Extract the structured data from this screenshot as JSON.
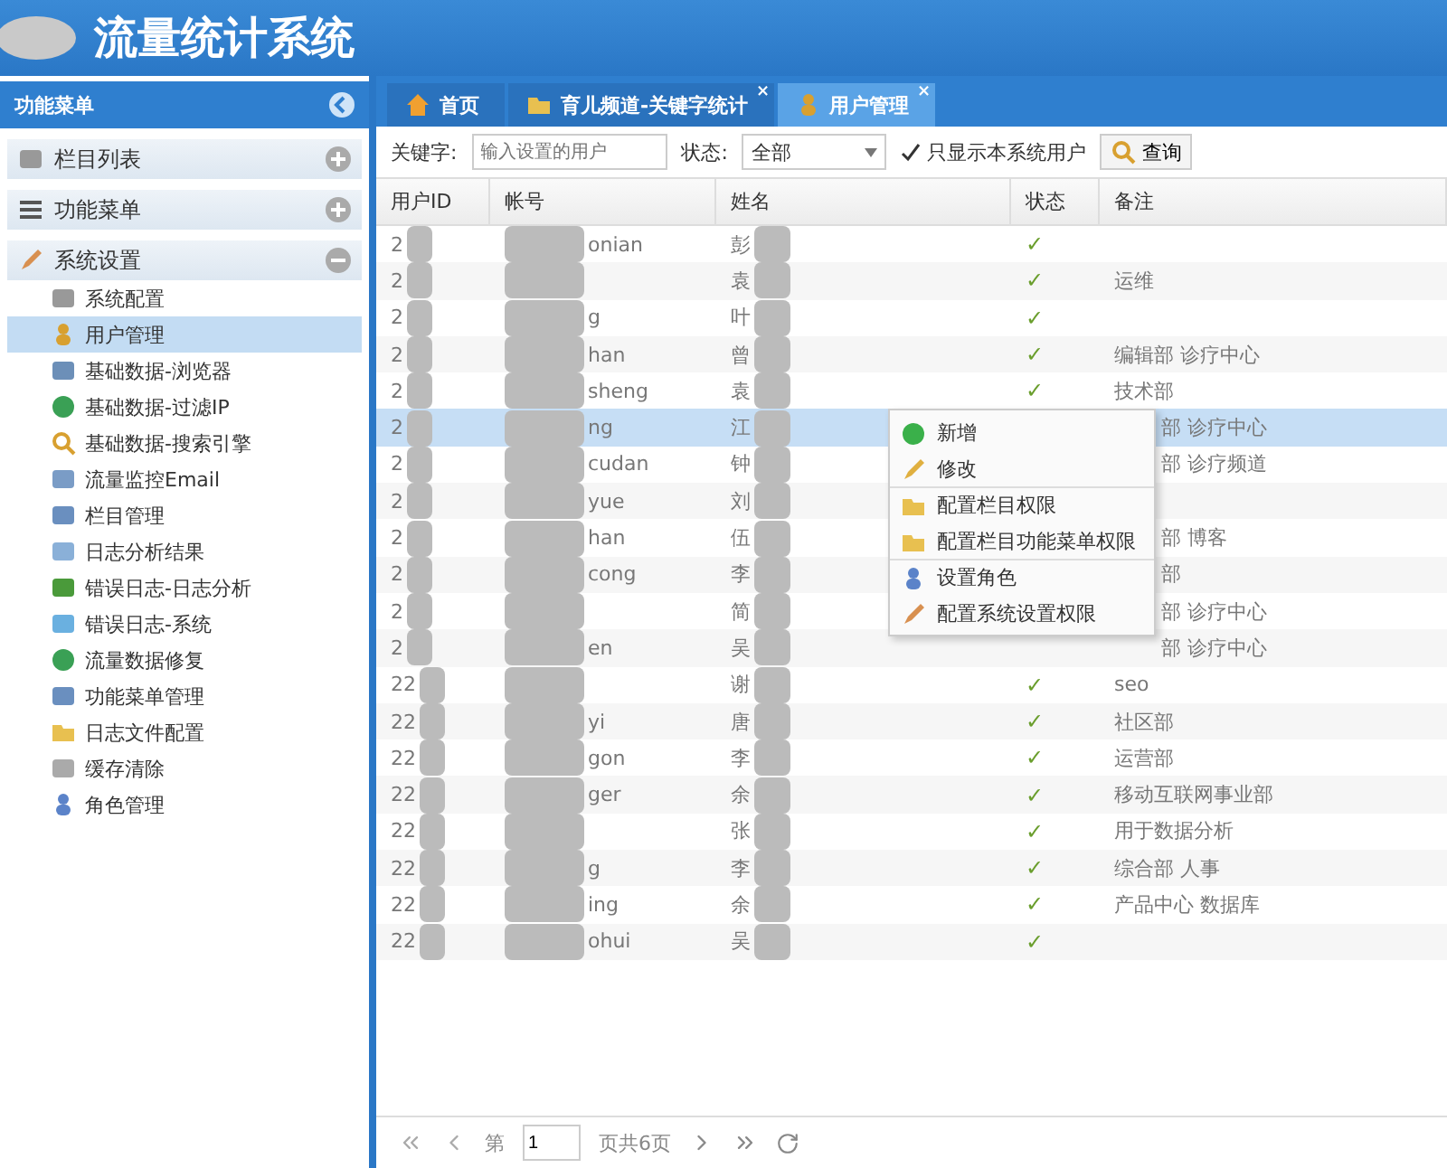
{
  "header": {
    "title": "流量统计系统"
  },
  "sidebar": {
    "title": "功能菜单",
    "sections": [
      {
        "label": "栏目列表",
        "expanded": false
      },
      {
        "label": "功能菜单",
        "expanded": false
      },
      {
        "label": "系统设置",
        "expanded": true,
        "items": [
          {
            "label": "系统配置",
            "selected": false
          },
          {
            "label": "用户管理",
            "selected": true
          },
          {
            "label": "基础数据-浏览器",
            "selected": false
          },
          {
            "label": "基础数据-过滤IP",
            "selected": false
          },
          {
            "label": "基础数据-搜索引擎",
            "selected": false
          },
          {
            "label": "流量监控Email",
            "selected": false
          },
          {
            "label": "栏目管理",
            "selected": false
          },
          {
            "label": "日志分析结果",
            "selected": false
          },
          {
            "label": "错误日志-日志分析",
            "selected": false
          },
          {
            "label": "错误日志-系统",
            "selected": false
          },
          {
            "label": "流量数据修复",
            "selected": false
          },
          {
            "label": "功能菜单管理",
            "selected": false
          },
          {
            "label": "日志文件配置",
            "selected": false
          },
          {
            "label": "缓存清除",
            "selected": false
          },
          {
            "label": "角色管理",
            "selected": false
          }
        ]
      }
    ]
  },
  "tabs": [
    {
      "label": "首页",
      "selected": false
    },
    {
      "label": "育儿频道-关键字统计",
      "selected": false,
      "close": "×"
    },
    {
      "label": "用户管理",
      "selected": true,
      "close": "×"
    }
  ],
  "toolbar": {
    "keyword_label": "关键字:",
    "keyword_placeholder": "输入设置的用户",
    "status_label": "状态:",
    "status_value": "全部",
    "only_system_users": {
      "label": "只显示本系统用户",
      "checked": true
    },
    "query_button": "查询"
  },
  "table": {
    "columns": [
      "用户ID",
      "帐号",
      "姓名",
      "状态",
      "备注"
    ],
    "rows": [
      {
        "id": "2",
        "account": "onian",
        "name": "彭",
        "status": "✓",
        "note": "",
        "selected": false
      },
      {
        "id": "2",
        "account": "",
        "name": "袁",
        "status": "✓",
        "note": "运维",
        "selected": false
      },
      {
        "id": "2",
        "account": "g",
        "name": "叶",
        "status": "✓",
        "note": "",
        "selected": false
      },
      {
        "id": "2",
        "account": "han",
        "name": "曾",
        "status": "✓",
        "note": "编辑部 诊疗中心",
        "selected": false
      },
      {
        "id": "2",
        "account": "sheng",
        "name": "袁",
        "status": "✓",
        "note": "技术部",
        "selected": false
      },
      {
        "id": "2",
        "account": "ng",
        "name": "江",
        "note": "部 诊疗中心",
        "selected": true
      },
      {
        "id": "2",
        "account": "cudan",
        "name": "钟",
        "note": "部 诊疗频道",
        "selected": false
      },
      {
        "id": "2",
        "account": "yue",
        "name": "刘",
        "note": "",
        "selected": false
      },
      {
        "id": "2",
        "account": "han",
        "name": "伍",
        "note": "部 博客",
        "selected": false
      },
      {
        "id": "2",
        "account": "cong",
        "name": "李",
        "note": "部",
        "selected": false
      },
      {
        "id": "2",
        "account": "",
        "name": "简",
        "note": "部 诊疗中心",
        "selected": false
      },
      {
        "id": "2",
        "account": "en",
        "name": "吴",
        "note": "部 诊疗中心",
        "selected": false
      },
      {
        "id": "22",
        "account": "",
        "name": "谢",
        "status": "✓",
        "note": "seo",
        "selected": false
      },
      {
        "id": "22",
        "account": "yi",
        "name": "唐",
        "status": "✓",
        "note": "社区部",
        "selected": false
      },
      {
        "id": "22",
        "account": "gon",
        "name": "李",
        "status": "✓",
        "note": "运营部",
        "selected": false
      },
      {
        "id": "22",
        "account": "ger",
        "name": "余",
        "status": "✓",
        "note": "移动互联网事业部",
        "selected": false
      },
      {
        "id": "22",
        "account": "",
        "name": "张",
        "status": "✓",
        "note": "用于数据分析",
        "selected": false
      },
      {
        "id": "22",
        "account": "g",
        "name": "李",
        "status": "✓",
        "note": "综合部 人事",
        "selected": false
      },
      {
        "id": "22",
        "account": "ing",
        "name": "余",
        "status": "✓",
        "note": "产品中心 数据库",
        "selected": false
      },
      {
        "id": "22",
        "account": "ohui",
        "name": "吴",
        "status": "✓",
        "note": "",
        "selected": false
      }
    ]
  },
  "context_menu": [
    {
      "label": "新增",
      "separator_before": false
    },
    {
      "label": "修改",
      "separator_before": false
    },
    {
      "label": "配置栏目权限",
      "separator_before": true
    },
    {
      "label": "配置栏目功能菜单权限",
      "separator_before": false
    },
    {
      "label": "设置角色",
      "separator_before": true
    },
    {
      "label": "配置系统设置权限",
      "separator_before": false
    }
  ],
  "pager": {
    "page_prefix": "第",
    "page_value": "1",
    "page_suffix": "页共6页"
  }
}
